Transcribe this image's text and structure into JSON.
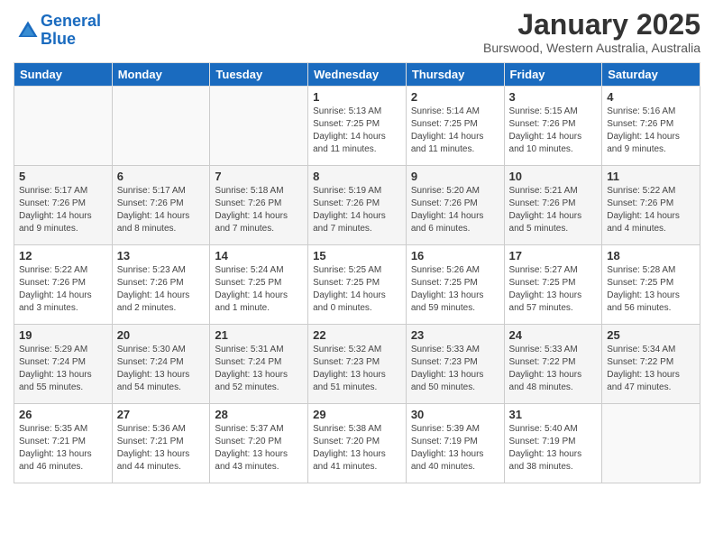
{
  "header": {
    "logo_line1": "General",
    "logo_line2": "Blue",
    "month_year": "January 2025",
    "location": "Burswood, Western Australia, Australia"
  },
  "weekdays": [
    "Sunday",
    "Monday",
    "Tuesday",
    "Wednesday",
    "Thursday",
    "Friday",
    "Saturday"
  ],
  "weeks": [
    [
      {
        "day": "",
        "info": ""
      },
      {
        "day": "",
        "info": ""
      },
      {
        "day": "",
        "info": ""
      },
      {
        "day": "1",
        "info": "Sunrise: 5:13 AM\nSunset: 7:25 PM\nDaylight: 14 hours\nand 11 minutes."
      },
      {
        "day": "2",
        "info": "Sunrise: 5:14 AM\nSunset: 7:25 PM\nDaylight: 14 hours\nand 11 minutes."
      },
      {
        "day": "3",
        "info": "Sunrise: 5:15 AM\nSunset: 7:26 PM\nDaylight: 14 hours\nand 10 minutes."
      },
      {
        "day": "4",
        "info": "Sunrise: 5:16 AM\nSunset: 7:26 PM\nDaylight: 14 hours\nand 9 minutes."
      }
    ],
    [
      {
        "day": "5",
        "info": "Sunrise: 5:17 AM\nSunset: 7:26 PM\nDaylight: 14 hours\nand 9 minutes."
      },
      {
        "day": "6",
        "info": "Sunrise: 5:17 AM\nSunset: 7:26 PM\nDaylight: 14 hours\nand 8 minutes."
      },
      {
        "day": "7",
        "info": "Sunrise: 5:18 AM\nSunset: 7:26 PM\nDaylight: 14 hours\nand 7 minutes."
      },
      {
        "day": "8",
        "info": "Sunrise: 5:19 AM\nSunset: 7:26 PM\nDaylight: 14 hours\nand 7 minutes."
      },
      {
        "day": "9",
        "info": "Sunrise: 5:20 AM\nSunset: 7:26 PM\nDaylight: 14 hours\nand 6 minutes."
      },
      {
        "day": "10",
        "info": "Sunrise: 5:21 AM\nSunset: 7:26 PM\nDaylight: 14 hours\nand 5 minutes."
      },
      {
        "day": "11",
        "info": "Sunrise: 5:22 AM\nSunset: 7:26 PM\nDaylight: 14 hours\nand 4 minutes."
      }
    ],
    [
      {
        "day": "12",
        "info": "Sunrise: 5:22 AM\nSunset: 7:26 PM\nDaylight: 14 hours\nand 3 minutes."
      },
      {
        "day": "13",
        "info": "Sunrise: 5:23 AM\nSunset: 7:26 PM\nDaylight: 14 hours\nand 2 minutes."
      },
      {
        "day": "14",
        "info": "Sunrise: 5:24 AM\nSunset: 7:25 PM\nDaylight: 14 hours\nand 1 minute."
      },
      {
        "day": "15",
        "info": "Sunrise: 5:25 AM\nSunset: 7:25 PM\nDaylight: 14 hours\nand 0 minutes."
      },
      {
        "day": "16",
        "info": "Sunrise: 5:26 AM\nSunset: 7:25 PM\nDaylight: 13 hours\nand 59 minutes."
      },
      {
        "day": "17",
        "info": "Sunrise: 5:27 AM\nSunset: 7:25 PM\nDaylight: 13 hours\nand 57 minutes."
      },
      {
        "day": "18",
        "info": "Sunrise: 5:28 AM\nSunset: 7:25 PM\nDaylight: 13 hours\nand 56 minutes."
      }
    ],
    [
      {
        "day": "19",
        "info": "Sunrise: 5:29 AM\nSunset: 7:24 PM\nDaylight: 13 hours\nand 55 minutes."
      },
      {
        "day": "20",
        "info": "Sunrise: 5:30 AM\nSunset: 7:24 PM\nDaylight: 13 hours\nand 54 minutes."
      },
      {
        "day": "21",
        "info": "Sunrise: 5:31 AM\nSunset: 7:24 PM\nDaylight: 13 hours\nand 52 minutes."
      },
      {
        "day": "22",
        "info": "Sunrise: 5:32 AM\nSunset: 7:23 PM\nDaylight: 13 hours\nand 51 minutes."
      },
      {
        "day": "23",
        "info": "Sunrise: 5:33 AM\nSunset: 7:23 PM\nDaylight: 13 hours\nand 50 minutes."
      },
      {
        "day": "24",
        "info": "Sunrise: 5:33 AM\nSunset: 7:22 PM\nDaylight: 13 hours\nand 48 minutes."
      },
      {
        "day": "25",
        "info": "Sunrise: 5:34 AM\nSunset: 7:22 PM\nDaylight: 13 hours\nand 47 minutes."
      }
    ],
    [
      {
        "day": "26",
        "info": "Sunrise: 5:35 AM\nSunset: 7:21 PM\nDaylight: 13 hours\nand 46 minutes."
      },
      {
        "day": "27",
        "info": "Sunrise: 5:36 AM\nSunset: 7:21 PM\nDaylight: 13 hours\nand 44 minutes."
      },
      {
        "day": "28",
        "info": "Sunrise: 5:37 AM\nSunset: 7:20 PM\nDaylight: 13 hours\nand 43 minutes."
      },
      {
        "day": "29",
        "info": "Sunrise: 5:38 AM\nSunset: 7:20 PM\nDaylight: 13 hours\nand 41 minutes."
      },
      {
        "day": "30",
        "info": "Sunrise: 5:39 AM\nSunset: 7:19 PM\nDaylight: 13 hours\nand 40 minutes."
      },
      {
        "day": "31",
        "info": "Sunrise: 5:40 AM\nSunset: 7:19 PM\nDaylight: 13 hours\nand 38 minutes."
      },
      {
        "day": "",
        "info": ""
      }
    ]
  ]
}
